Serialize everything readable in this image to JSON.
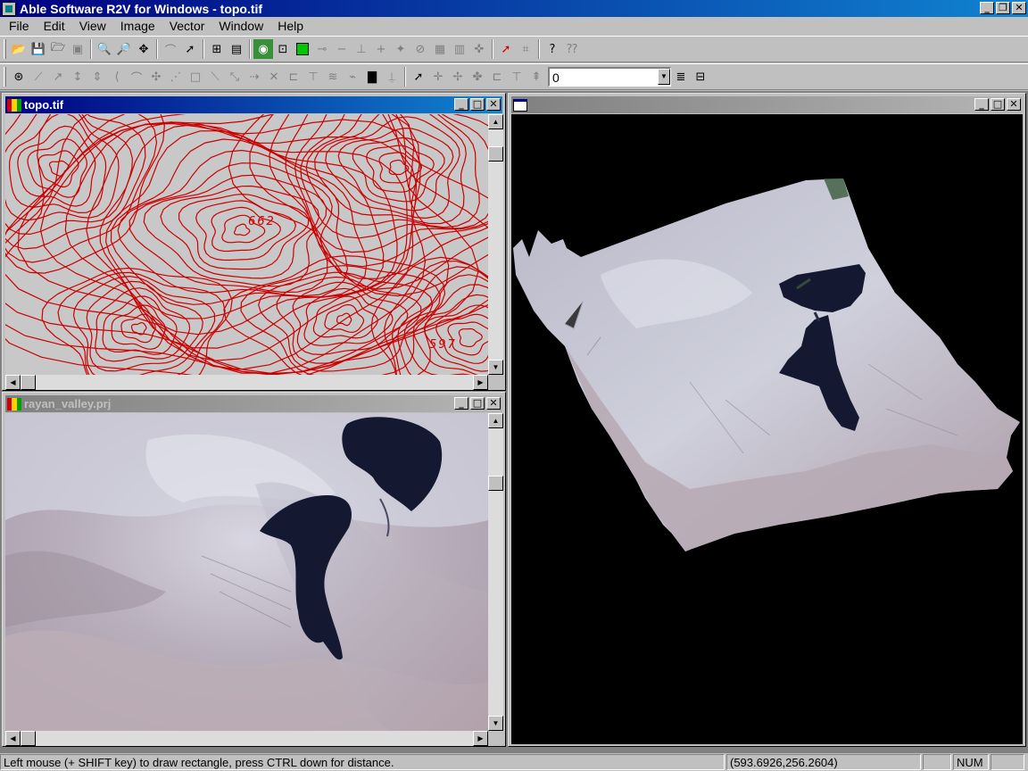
{
  "window": {
    "title": "Able Software R2V for Windows - topo.tif",
    "minimize": "_",
    "restore": "❐",
    "close": "✕"
  },
  "menu": [
    "File",
    "Edit",
    "View",
    "Image",
    "Vector",
    "Window",
    "Help"
  ],
  "toolbar": {
    "layer_value": "0"
  },
  "windows": {
    "topo": {
      "title": "topo.tif",
      "contour_labels": [
        "662",
        "597"
      ],
      "line_color": "#cc0000",
      "background_color": "#c8c8c8"
    },
    "project": {
      "title": "rayan_valley.prj"
    },
    "view3d": {
      "title": "",
      "background_color": "#000000"
    }
  },
  "statusbar": {
    "hint": "Left mouse (+ SHIFT key) to draw rectangle, press CTRL down for distance.",
    "coords": "(593.6926,256.2604)",
    "num": "NUM"
  },
  "icons": {
    "toolbar1": [
      "open-icon",
      "save-icon",
      "open-project-icon",
      "close-icon",
      "zoom-in-icon",
      "zoom-out-icon",
      "pan-icon",
      "trace-icon",
      "select-icon",
      "image-settings-icon",
      "scan-icon",
      "color-select-icon",
      "fit-icon",
      "green-box-icon",
      "node-icon",
      "line-icon",
      "split-icon",
      "join-icon",
      "point-icon",
      "delete-icon",
      "grid-icon",
      "grid2-icon",
      "cross-icon",
      "clear-select-icon",
      "edit-select-icon",
      "help-icon",
      "context-help-icon"
    ],
    "toolbar2": [
      "edit-node-icon",
      "draw-line-icon",
      "draw-line2-icon",
      "move-vertex-icon",
      "split-vertex-icon",
      "add-arc-icon",
      "arc-icon",
      "join-node-icon",
      "node-edit-icon",
      "rectangle-icon",
      "diagonal-icon",
      "rotate-icon",
      "connect-icon",
      "close-x-icon",
      "id-icon",
      "label-icon",
      "contour-icon",
      "smooth-icon",
      "fill-icon",
      "label2-icon",
      "pointer-icon",
      "add-point-icon",
      "delete-point-icon",
      "move-point-icon",
      "id-point-icon",
      "text-point-icon",
      "z-icon",
      "layer-list-icon",
      "layer-edit-icon"
    ]
  }
}
